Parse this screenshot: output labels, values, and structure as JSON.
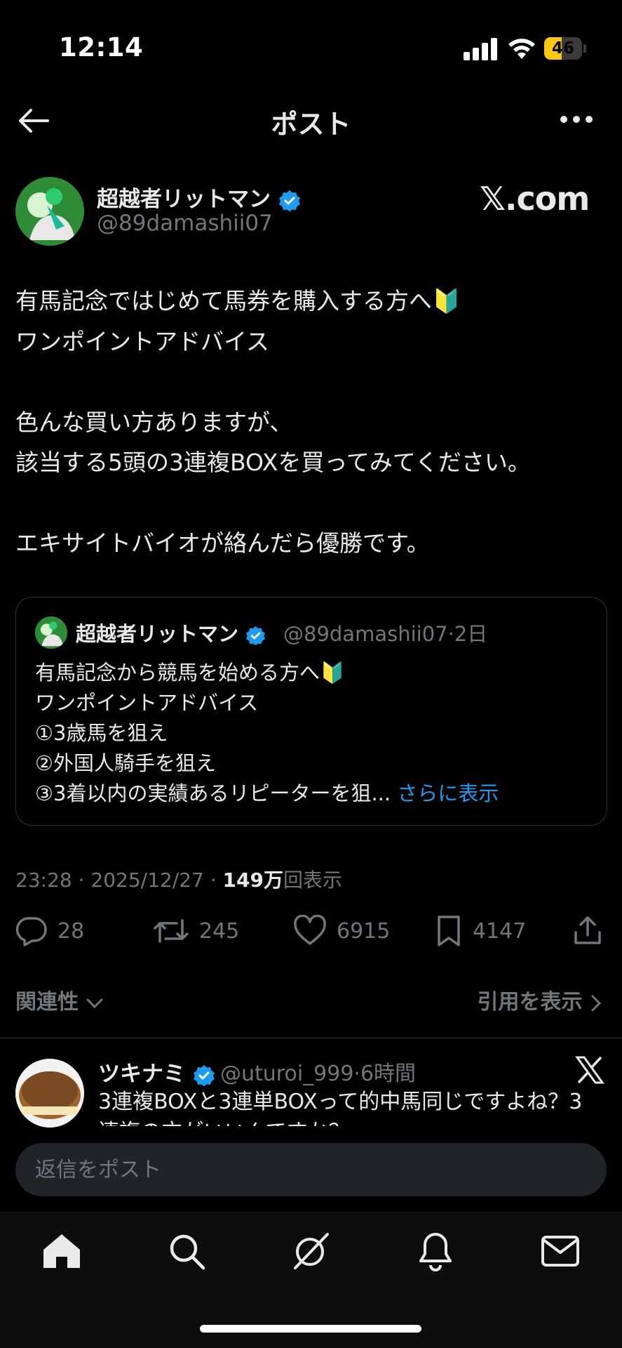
{
  "status": {
    "time": "12:14",
    "battery": "46",
    "battery_level": 0.46
  },
  "nav": {
    "title": "ポスト"
  },
  "post": {
    "author_name": "超越者リットマン",
    "handle": "@89damashii07",
    "watermark": "𝕏.com",
    "lines": [
      "有馬記念ではじめて馬券を購入する方へ🔰",
      "ワンポイントアドバイス",
      "",
      "色んな買い方ありますが、",
      "該当する5頭の3連複BOXを買ってみてください。",
      "",
      "エキサイトバイオが絡んだら優勝です。"
    ],
    "time": "23:28",
    "date": "2025/12/27",
    "views_count": "149万",
    "views_label": "回表示"
  },
  "quote": {
    "author_name": "超越者リットマン",
    "handle": "@89damashii07",
    "age": "2日",
    "lines": [
      "有馬記念から競馬を始める方へ🔰",
      "ワンポイントアドバイス",
      "①3歳馬を狙え",
      "②外国人騎手を狙え",
      "③3着以内の実績あるリピーターを狙..."
    ],
    "more_label": "さらに表示"
  },
  "actions": {
    "replies": "28",
    "reposts": "245",
    "likes": "6915",
    "bookmarks": "4147"
  },
  "sort": {
    "relevance_label": "関連性",
    "quotes_label": "引用を表示"
  },
  "reply": {
    "author_name": "ツキナミ",
    "handle": "@uturoi_999",
    "age": "6時間",
    "line1": "3連複BOXと3連単BOXって的中馬同じですよね？3",
    "line2": "連複の方がいいんですか？"
  },
  "composer": {
    "placeholder": "返信をポスト"
  },
  "colors": {
    "accent": "#1d9bf0",
    "muted": "#71767b",
    "text": "#e7e9ea",
    "background": "#000000"
  },
  "tabs": [
    "home-icon",
    "search-icon",
    "grok-icon",
    "notifications-icon",
    "messages-icon"
  ]
}
